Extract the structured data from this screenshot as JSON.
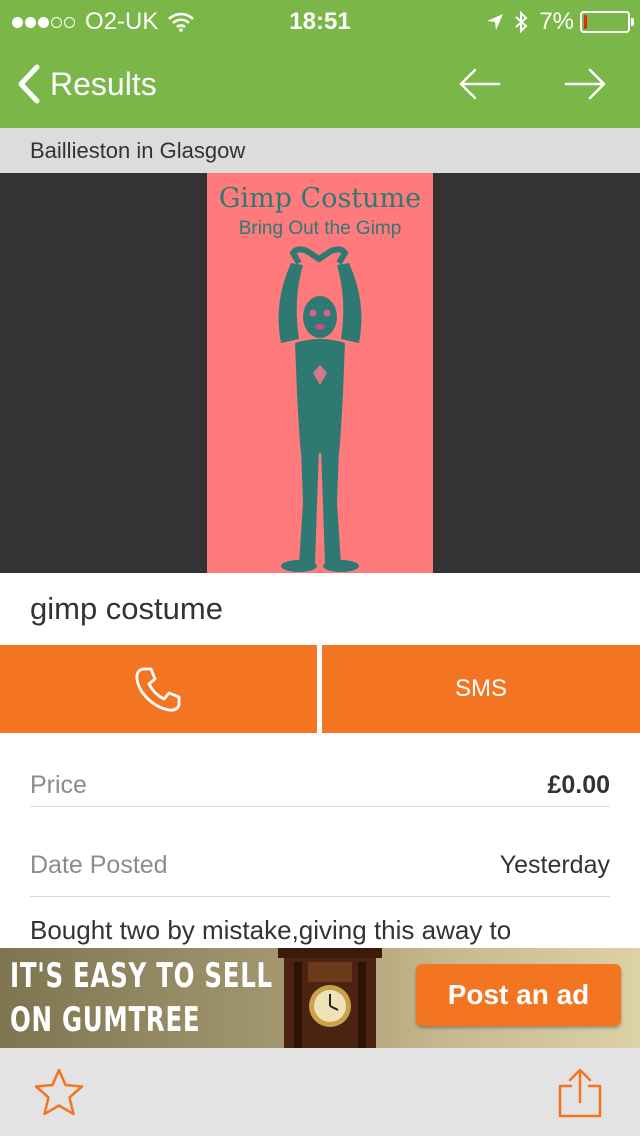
{
  "status_bar": {
    "carrier": "O2-UK",
    "time": "18:51",
    "battery": "7%",
    "signal_bars_filled": 3,
    "signal_bars_total": 5,
    "battery_level": 0.07,
    "icons": [
      "wifi-icon",
      "location-arrow-icon",
      "bluetooth-icon",
      "battery-icon"
    ]
  },
  "nav": {
    "back_label": "Results",
    "icons": [
      "chevron-left-icon",
      "arrow-left-icon",
      "arrow-right-icon"
    ]
  },
  "listing": {
    "location": "Baillieston in Glasgow",
    "title": "gimp costume",
    "image": {
      "title": "Gimp Costume",
      "subtitle": "Bring Out the Gimp"
    }
  },
  "actions": {
    "call_icon": "phone-icon",
    "sms_label": "SMS"
  },
  "details": [
    {
      "key": "Price",
      "value": "£0.00",
      "emphasis": true
    },
    {
      "key": "Date Posted",
      "value": "Yesterday",
      "emphasis": false
    }
  ],
  "description": "Bought two by mistake,giving this away to",
  "ad_banner": {
    "headline_line1": "IT'S EASY TO SELL",
    "headline_line2": "ON GUMTREE",
    "cta": "Post an ad"
  },
  "toolbar": {
    "icons": [
      "star-icon",
      "share-icon"
    ]
  },
  "colors": {
    "header_green": "#7ab648",
    "accent_orange": "#f37522",
    "location_bar": "#dcdcdc",
    "hero_background": "#333333",
    "poster_background": "#ff7a7c",
    "poster_text": "#2e7a72",
    "toolbar_background": "#e3e3e3",
    "battery_low": "#e0261d"
  }
}
